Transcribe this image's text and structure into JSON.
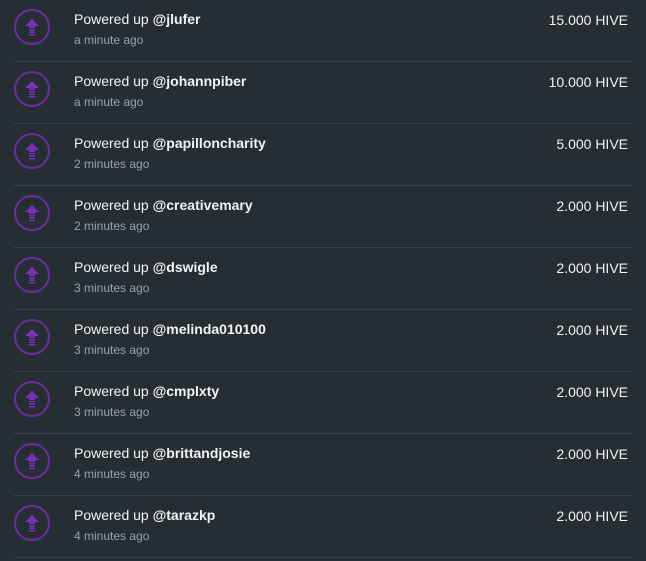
{
  "colors": {
    "background": "#262d33",
    "divider": "#3a4249",
    "icon_accent": "#6b2fa0",
    "text_primary": "#f2f3f4",
    "text_secondary": "#9aa2a9"
  },
  "transactions": [
    {
      "action": "Powered up",
      "user": "@jlufer",
      "time": "a minute ago",
      "amount": "15.000 HIVE",
      "icon": "power-up-arrow-icon"
    },
    {
      "action": "Powered up",
      "user": "@johannpiber",
      "time": "a minute ago",
      "amount": "10.000 HIVE",
      "icon": "power-up-arrow-icon"
    },
    {
      "action": "Powered up",
      "user": "@papilloncharity",
      "time": "2 minutes ago",
      "amount": "5.000 HIVE",
      "icon": "power-up-arrow-icon"
    },
    {
      "action": "Powered up",
      "user": "@creativemary",
      "time": "2 minutes ago",
      "amount": "2.000 HIVE",
      "icon": "power-up-arrow-icon"
    },
    {
      "action": "Powered up",
      "user": "@dswigle",
      "time": "3 minutes ago",
      "amount": "2.000 HIVE",
      "icon": "power-up-arrow-icon"
    },
    {
      "action": "Powered up",
      "user": "@melinda010100",
      "time": "3 minutes ago",
      "amount": "2.000 HIVE",
      "icon": "power-up-arrow-icon"
    },
    {
      "action": "Powered up",
      "user": "@cmplxty",
      "time": "3 minutes ago",
      "amount": "2.000 HIVE",
      "icon": "power-up-arrow-icon"
    },
    {
      "action": "Powered up",
      "user": "@brittandjosie",
      "time": "4 minutes ago",
      "amount": "2.000 HIVE",
      "icon": "power-up-arrow-icon"
    },
    {
      "action": "Powered up",
      "user": "@tarazkp",
      "time": "4 minutes ago",
      "amount": "2.000 HIVE",
      "icon": "power-up-arrow-icon"
    }
  ]
}
